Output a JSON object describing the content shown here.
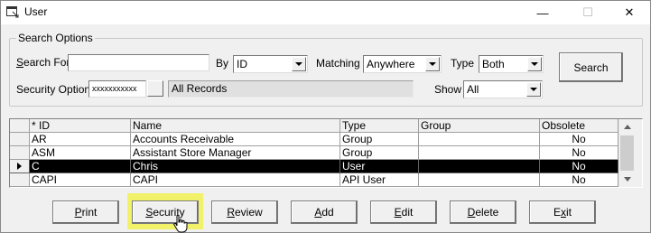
{
  "window": {
    "title": "User"
  },
  "titlebar": {
    "minimize": "—",
    "maximize": "☐",
    "close": "✕"
  },
  "search": {
    "group_title": "Search Options",
    "search_for_label": "Search For",
    "search_for_value": "",
    "by_label": "By",
    "by_value": "ID",
    "matching_label": "Matching",
    "matching_value": "Anywhere",
    "type_label": "Type",
    "type_value": "Both",
    "search_button": "Search",
    "security_option_label": "Security Option",
    "security_option_value": "xxxxxxxxxxx",
    "records_value": "All Records",
    "show_label": "Show",
    "show_value": "All"
  },
  "grid": {
    "columns": [
      "* ID",
      "Name",
      "Type",
      "Group",
      "Obsolete"
    ],
    "rows": [
      {
        "id": "AR",
        "name": "Accounts Receivable",
        "type": "Group",
        "group": "",
        "obsolete": "No",
        "selected": false
      },
      {
        "id": "ASM",
        "name": "Assistant Store Manager",
        "type": "Group",
        "group": "",
        "obsolete": "No",
        "selected": false
      },
      {
        "id": "C",
        "name": "Chris",
        "type": "User",
        "group": "",
        "obsolete": "No",
        "selected": true
      },
      {
        "id": "CAPI",
        "name": "CAPI",
        "type": "API User",
        "group": "",
        "obsolete": "No",
        "selected": false
      }
    ]
  },
  "buttons": {
    "print": "Print",
    "security": "Security",
    "review": "Review",
    "add": "Add",
    "edit": "Edit",
    "delete": "Delete",
    "exit": "Exit"
  },
  "colors": {
    "highlight": "#f2f252",
    "selected_row": "#000000"
  },
  "icons": {
    "window": "window-icon",
    "dropdown": "chevron-down-icon",
    "cursor": "pointer-cursor-icon"
  }
}
